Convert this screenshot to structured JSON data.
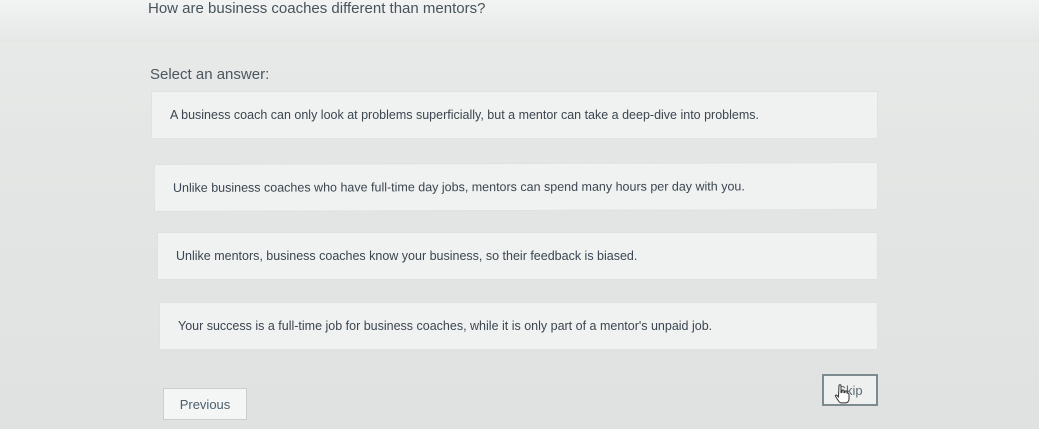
{
  "question": {
    "text": "How are business coaches different than mentors?",
    "prompt": "Select an answer:"
  },
  "answers": [
    {
      "label": "A business coach can only look at problems superficially, but a mentor can take a deep-dive into problems."
    },
    {
      "label": "Unlike business coaches who have full-time day jobs, mentors can spend many hours per day with you."
    },
    {
      "label": "Unlike mentors, business coaches know your business, so their feedback is biased."
    },
    {
      "label": "Your success is a full-time job for business coaches, while it is only part of a mentor's unpaid job."
    }
  ],
  "navigation": {
    "previous_label": "Previous",
    "skip_label": "Skip"
  },
  "icons": {
    "cursor": "hand-pointer-icon"
  }
}
